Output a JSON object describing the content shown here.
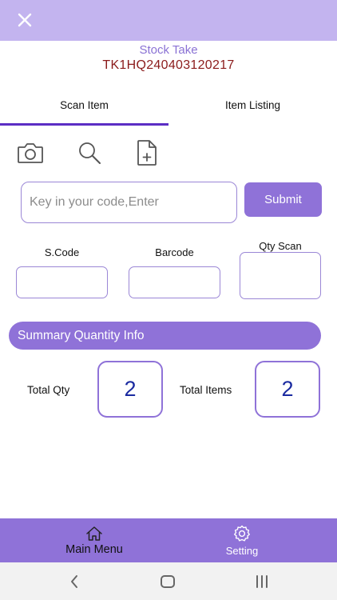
{
  "header": {
    "close_icon": "close-icon"
  },
  "page": {
    "title": "Stock Take",
    "code": "TK1HQ240403120217"
  },
  "tabs": [
    {
      "label": "Scan Item",
      "active": true
    },
    {
      "label": "Item Listing",
      "active": false
    }
  ],
  "toolbar": {
    "icons": [
      "camera-icon",
      "search-icon",
      "add-file-icon"
    ]
  },
  "scan": {
    "placeholder": "Key in your code,Enter",
    "value": "",
    "submit_label": "Submit"
  },
  "fields": {
    "scode_label": "S.Code",
    "barcode_label": "Barcode",
    "qty_scan_label": "Qty Scan"
  },
  "summary": {
    "title": "Summary Quantity Info",
    "total_qty_label": "Total Qty",
    "total_qty_value": "2",
    "total_items_label": "Total Items",
    "total_items_value": "2"
  },
  "bottom_nav": {
    "main_menu_label": "Main Menu",
    "setting_label": "Setting"
  },
  "colors": {
    "accent": "#8f72d8",
    "topbar": "#c3b4ef",
    "tab_indicator": "#5b2ec4",
    "code_text": "#8b1b1b",
    "qty_value": "#1a2aa0"
  }
}
